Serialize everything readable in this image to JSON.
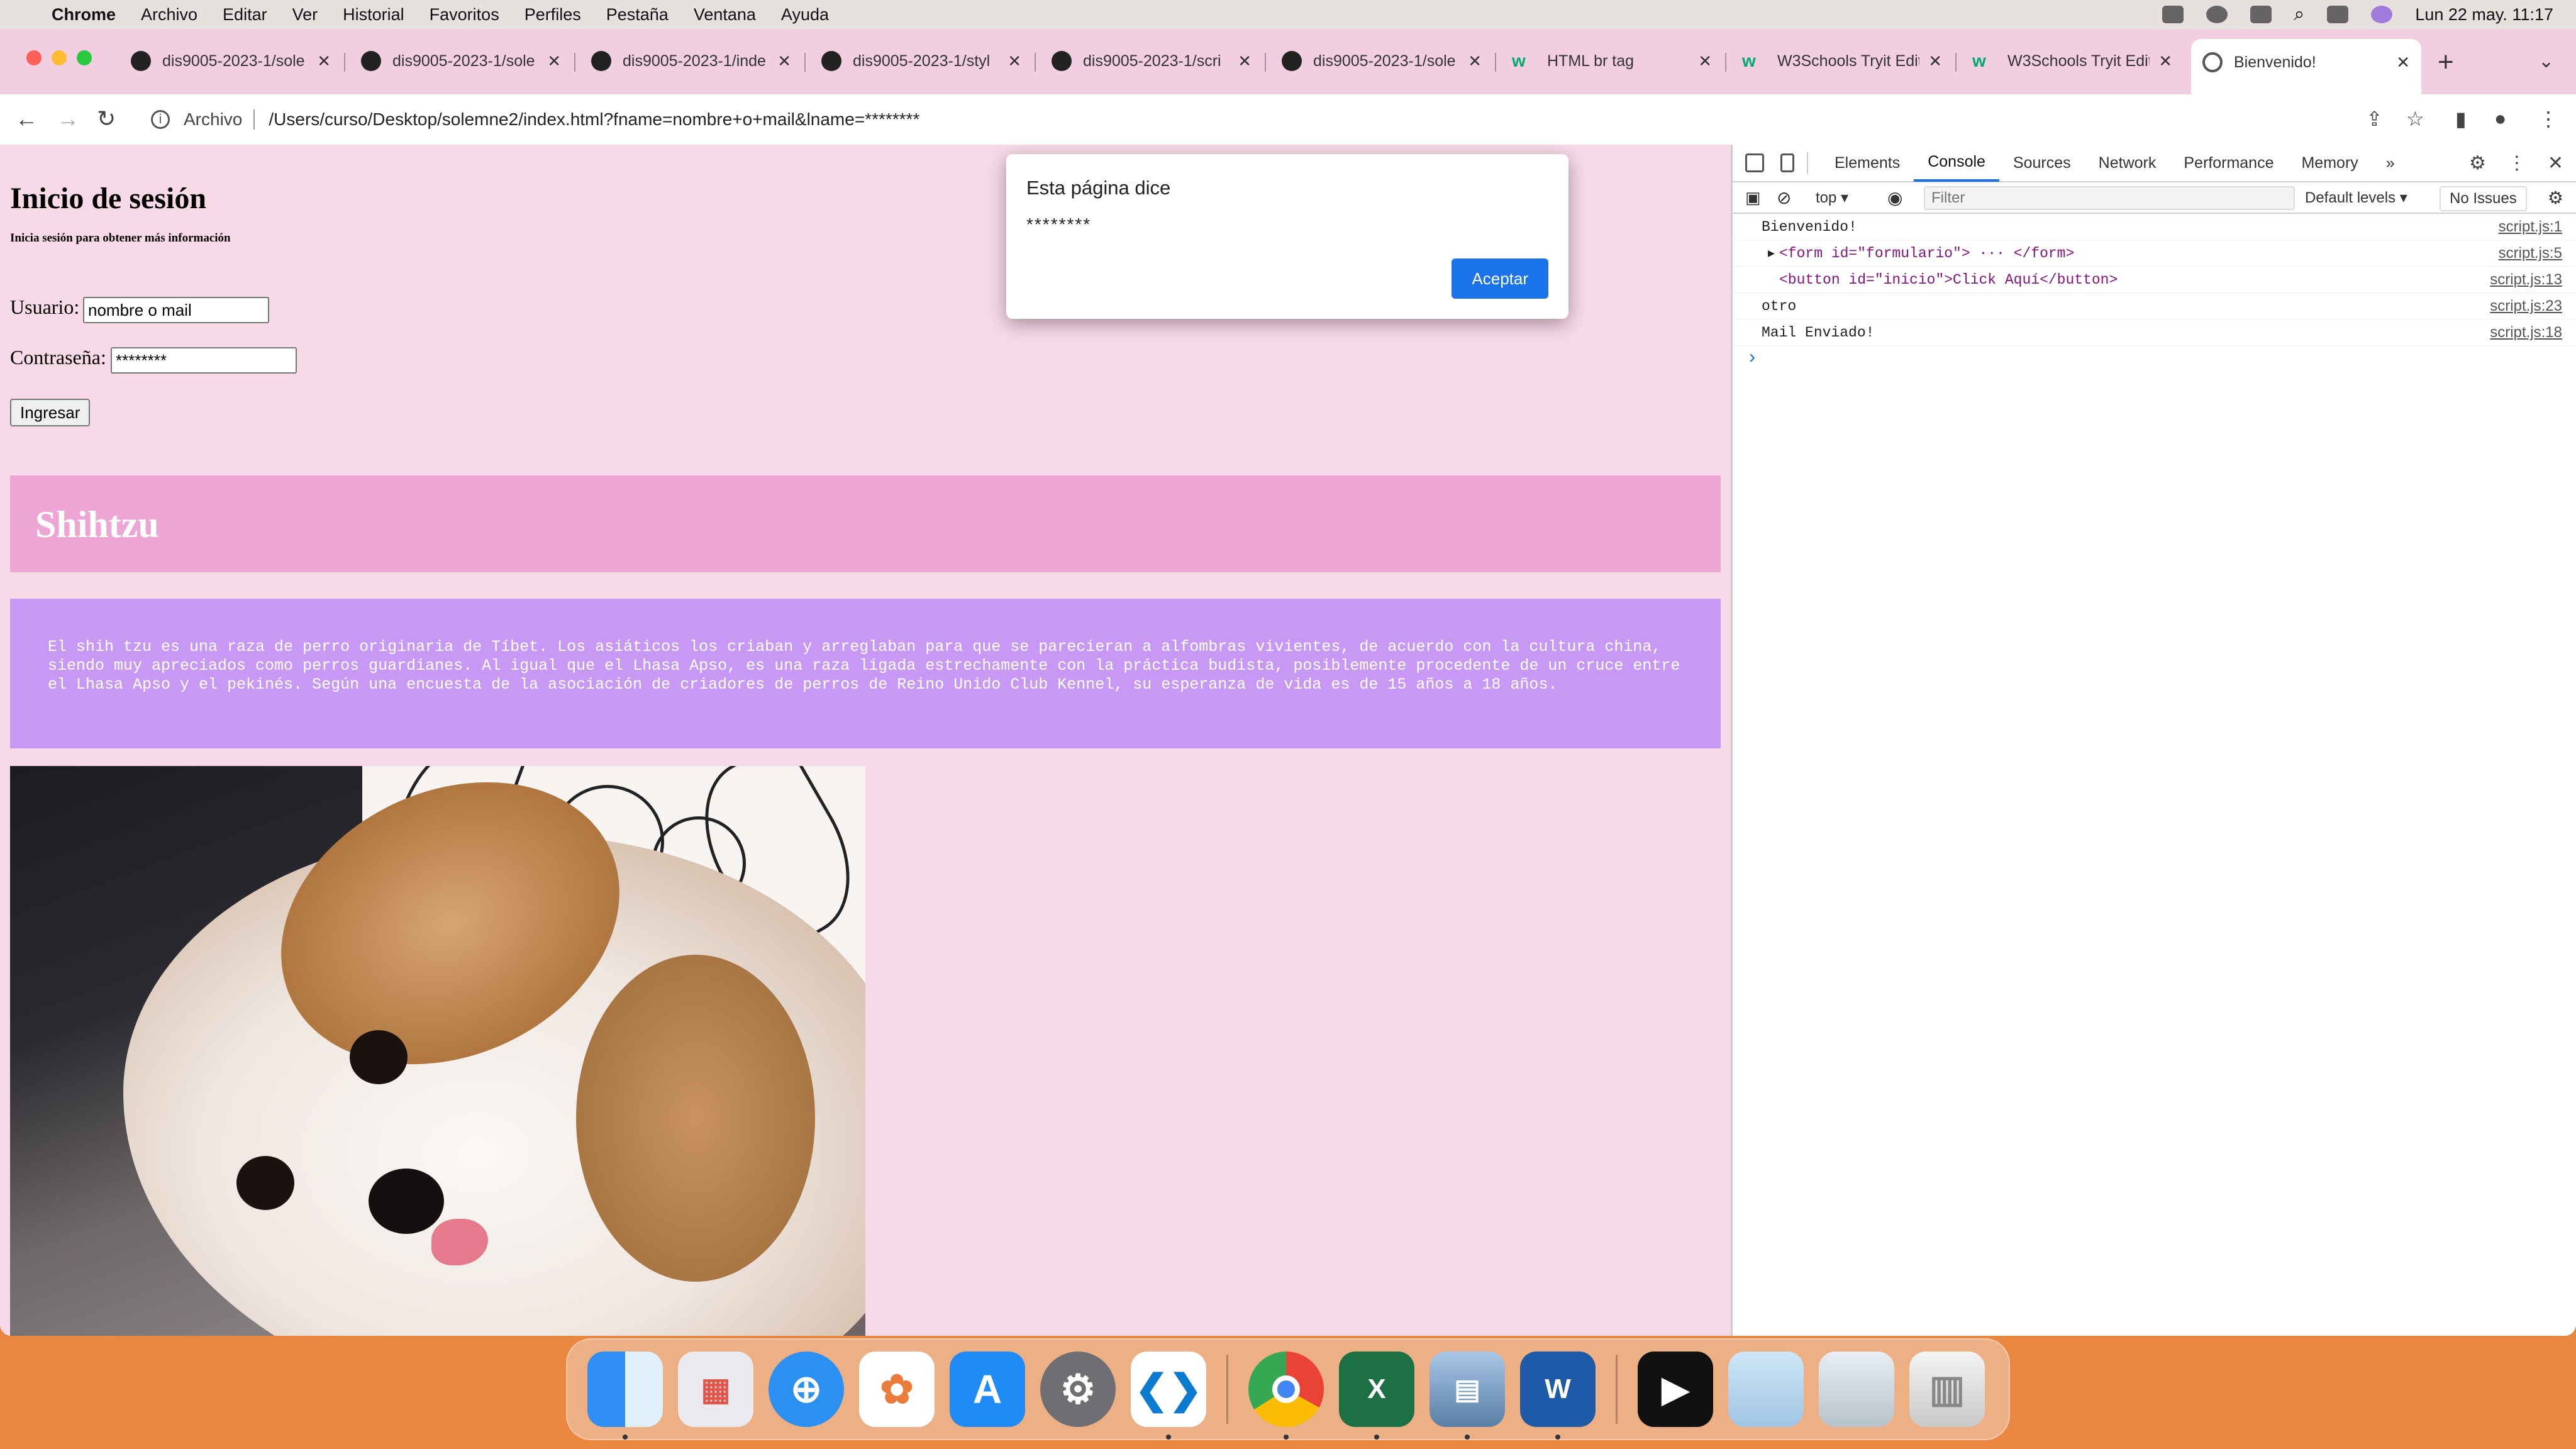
{
  "menubar": {
    "app": "Chrome",
    "items": [
      "Archivo",
      "Editar",
      "Ver",
      "Historial",
      "Favoritos",
      "Perfiles",
      "Pestaña",
      "Ventana",
      "Ayuda"
    ],
    "clock": "Lun 22 may.  11:17"
  },
  "tabs": [
    {
      "title": "dis9005-2023-1/sole",
      "icon": "github-icon"
    },
    {
      "title": "dis9005-2023-1/sole",
      "icon": "github-icon"
    },
    {
      "title": "dis9005-2023-1/inde",
      "icon": "github-icon"
    },
    {
      "title": "dis9005-2023-1/styl",
      "icon": "github-icon"
    },
    {
      "title": "dis9005-2023-1/scri",
      "icon": "github-icon"
    },
    {
      "title": "dis9005-2023-1/sole",
      "icon": "github-icon"
    },
    {
      "title": "HTML br tag",
      "icon": "w3schools-icon"
    },
    {
      "title": "W3Schools Tryit Edit",
      "icon": "w3schools-icon"
    },
    {
      "title": "W3Schools Tryit Edit",
      "icon": "w3schools-icon"
    },
    {
      "title": "Bienvenido!",
      "icon": "globe-icon",
      "active": true
    }
  ],
  "address": {
    "scheme": "Archivo",
    "url": "/Users/curso/Desktop/solemne2/index.html?fname=nombre+o+mail&lname=********"
  },
  "page": {
    "title": "Inicio de sesión",
    "subtitle": "Inicia sesión para obtener más información",
    "user_label": "Usuario:",
    "user_value": "nombre o mail",
    "pass_label": "Contraseña:",
    "pass_value": "********",
    "submit_label": "Ingresar",
    "banner_title": "Shihtzu",
    "description": "El shih tzu es una raza de perro originaria de Tíbet. Los asiáticos los criaban y arreglaban para que se parecieran a alfombras vivientes, de acuerdo con la cultura china, siendo muy apreciados como perros guardianes. Al igual que el Lhasa Apso, es una raza ligada estrechamente con la práctica budista, posiblemente procedente de un cruce entre el Lhasa Apso y el pekinés. Según una encuesta de la asociación de criadores de perros de Reino Unido Club Kennel, su esperanza de vida es de 15 años a 18 años."
  },
  "alert": {
    "title": "Esta página dice",
    "message": "********",
    "ok_label": "Aceptar"
  },
  "devtools": {
    "tabs": [
      "Elements",
      "Console",
      "Sources",
      "Network",
      "Performance",
      "Memory"
    ],
    "active_tab": "Console",
    "context": "top ▾",
    "filter_placeholder": "Filter",
    "levels": "Default levels ▾",
    "issues": "No Issues",
    "console": [
      {
        "text": "Bienvenido!",
        "source": "script.js:1"
      },
      {
        "text": "<form id=\"formulario\"> ··· </form>",
        "source": "script.js:5"
      },
      {
        "text": "<button id=\"inicio\">Click Aquí</button>",
        "source": "script.js:13"
      },
      {
        "text": "otro",
        "source": "script.js:23"
      },
      {
        "text": "Mail Enviado!",
        "source": "script.js:18"
      }
    ]
  },
  "dock": {
    "apps": [
      "Finder",
      "Launchpad",
      "Safari",
      "Photos",
      "App Store",
      "System Settings",
      "VS Code",
      "Chrome",
      "Excel",
      "Preview",
      "Word",
      "Screen Recording",
      "Image 1",
      "Image 2",
      "Trash"
    ]
  },
  "colors": {
    "page_bg": "#f8d9e8",
    "banner_bg": "#eda5d3",
    "desc_bg": "#c899f4",
    "accent": "#1a73e8"
  }
}
